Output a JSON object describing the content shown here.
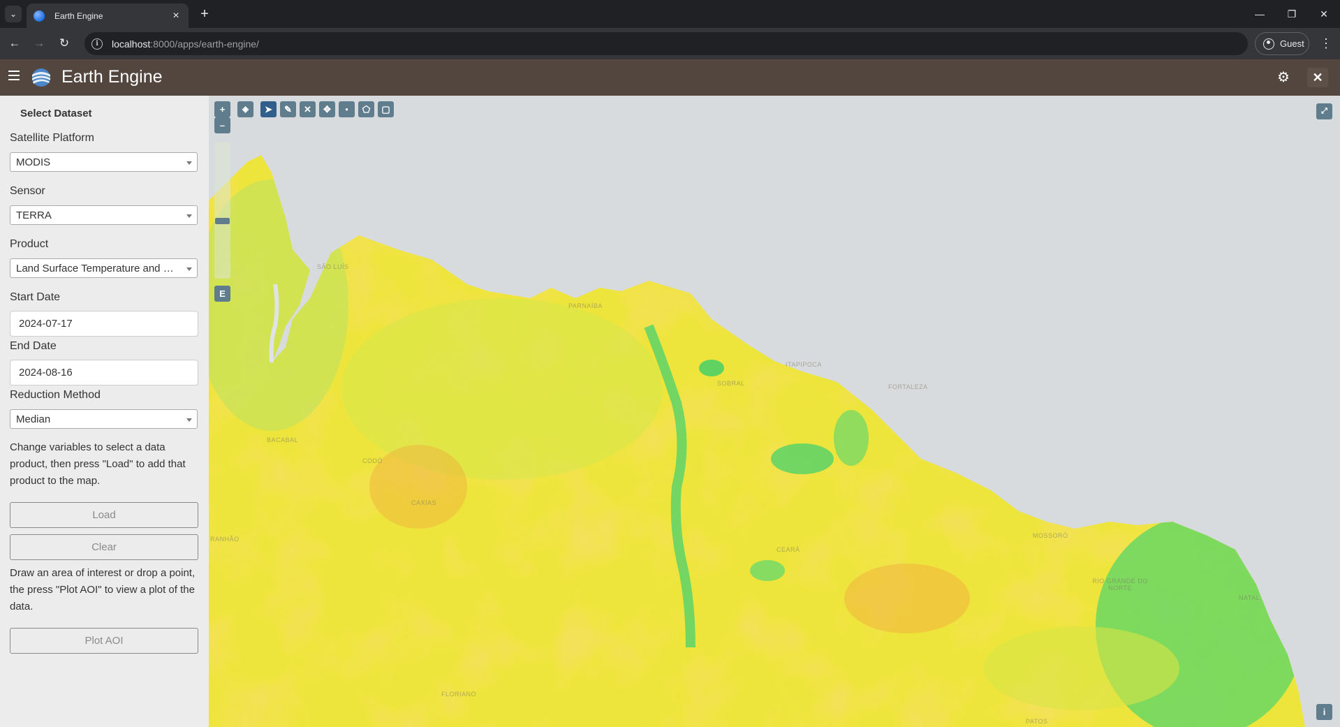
{
  "browser": {
    "tab_title": "Earth Engine",
    "url_host": "localhost",
    "url_path": ":8000/apps/earth-engine/",
    "profile_label": "Guest"
  },
  "app": {
    "title": "Earth Engine"
  },
  "sidebar": {
    "heading": "Select Dataset",
    "platform_label": "Satellite Platform",
    "platform_value": "MODIS",
    "sensor_label": "Sensor",
    "sensor_value": "TERRA",
    "product_label": "Product",
    "product_value": "Land Surface Temperature and Emissivity",
    "start_label": "Start Date",
    "start_value": "2024-07-17",
    "end_label": "End Date",
    "end_value": "2024-08-16",
    "reduction_label": "Reduction Method",
    "reduction_value": "Median",
    "help_load": "Change variables to select a data product, then press \"Load\" to add that product to the map.",
    "load_label": "Load",
    "clear_label": "Clear",
    "help_plot": "Draw an area of interest or drop a point, the press \"Plot AOI\" to view a plot of the data.",
    "plot_label": "Plot AOI"
  },
  "map": {
    "zoom_in": "+",
    "zoom_out": "–",
    "extent_label": "E",
    "info_label": "i",
    "places": [
      "SÃO LUÍS",
      "PARNAÍBA",
      "ITAPIPOCA",
      "FORTALEZA",
      "BACABAL",
      "CODÓ",
      "CAXIAS",
      "CEARÁ",
      "MOSSORÓ",
      "RIO GRANDE DO NORTE",
      "NATAL",
      "FLORIANO",
      "PATOS",
      "RANHÃO",
      "SOBRAL"
    ],
    "colors": {
      "ocean": "#d7dbdd",
      "land_warm": "#f2e83a",
      "land_hot": "#f5b93a",
      "land_cool": "#4fd66a"
    }
  }
}
